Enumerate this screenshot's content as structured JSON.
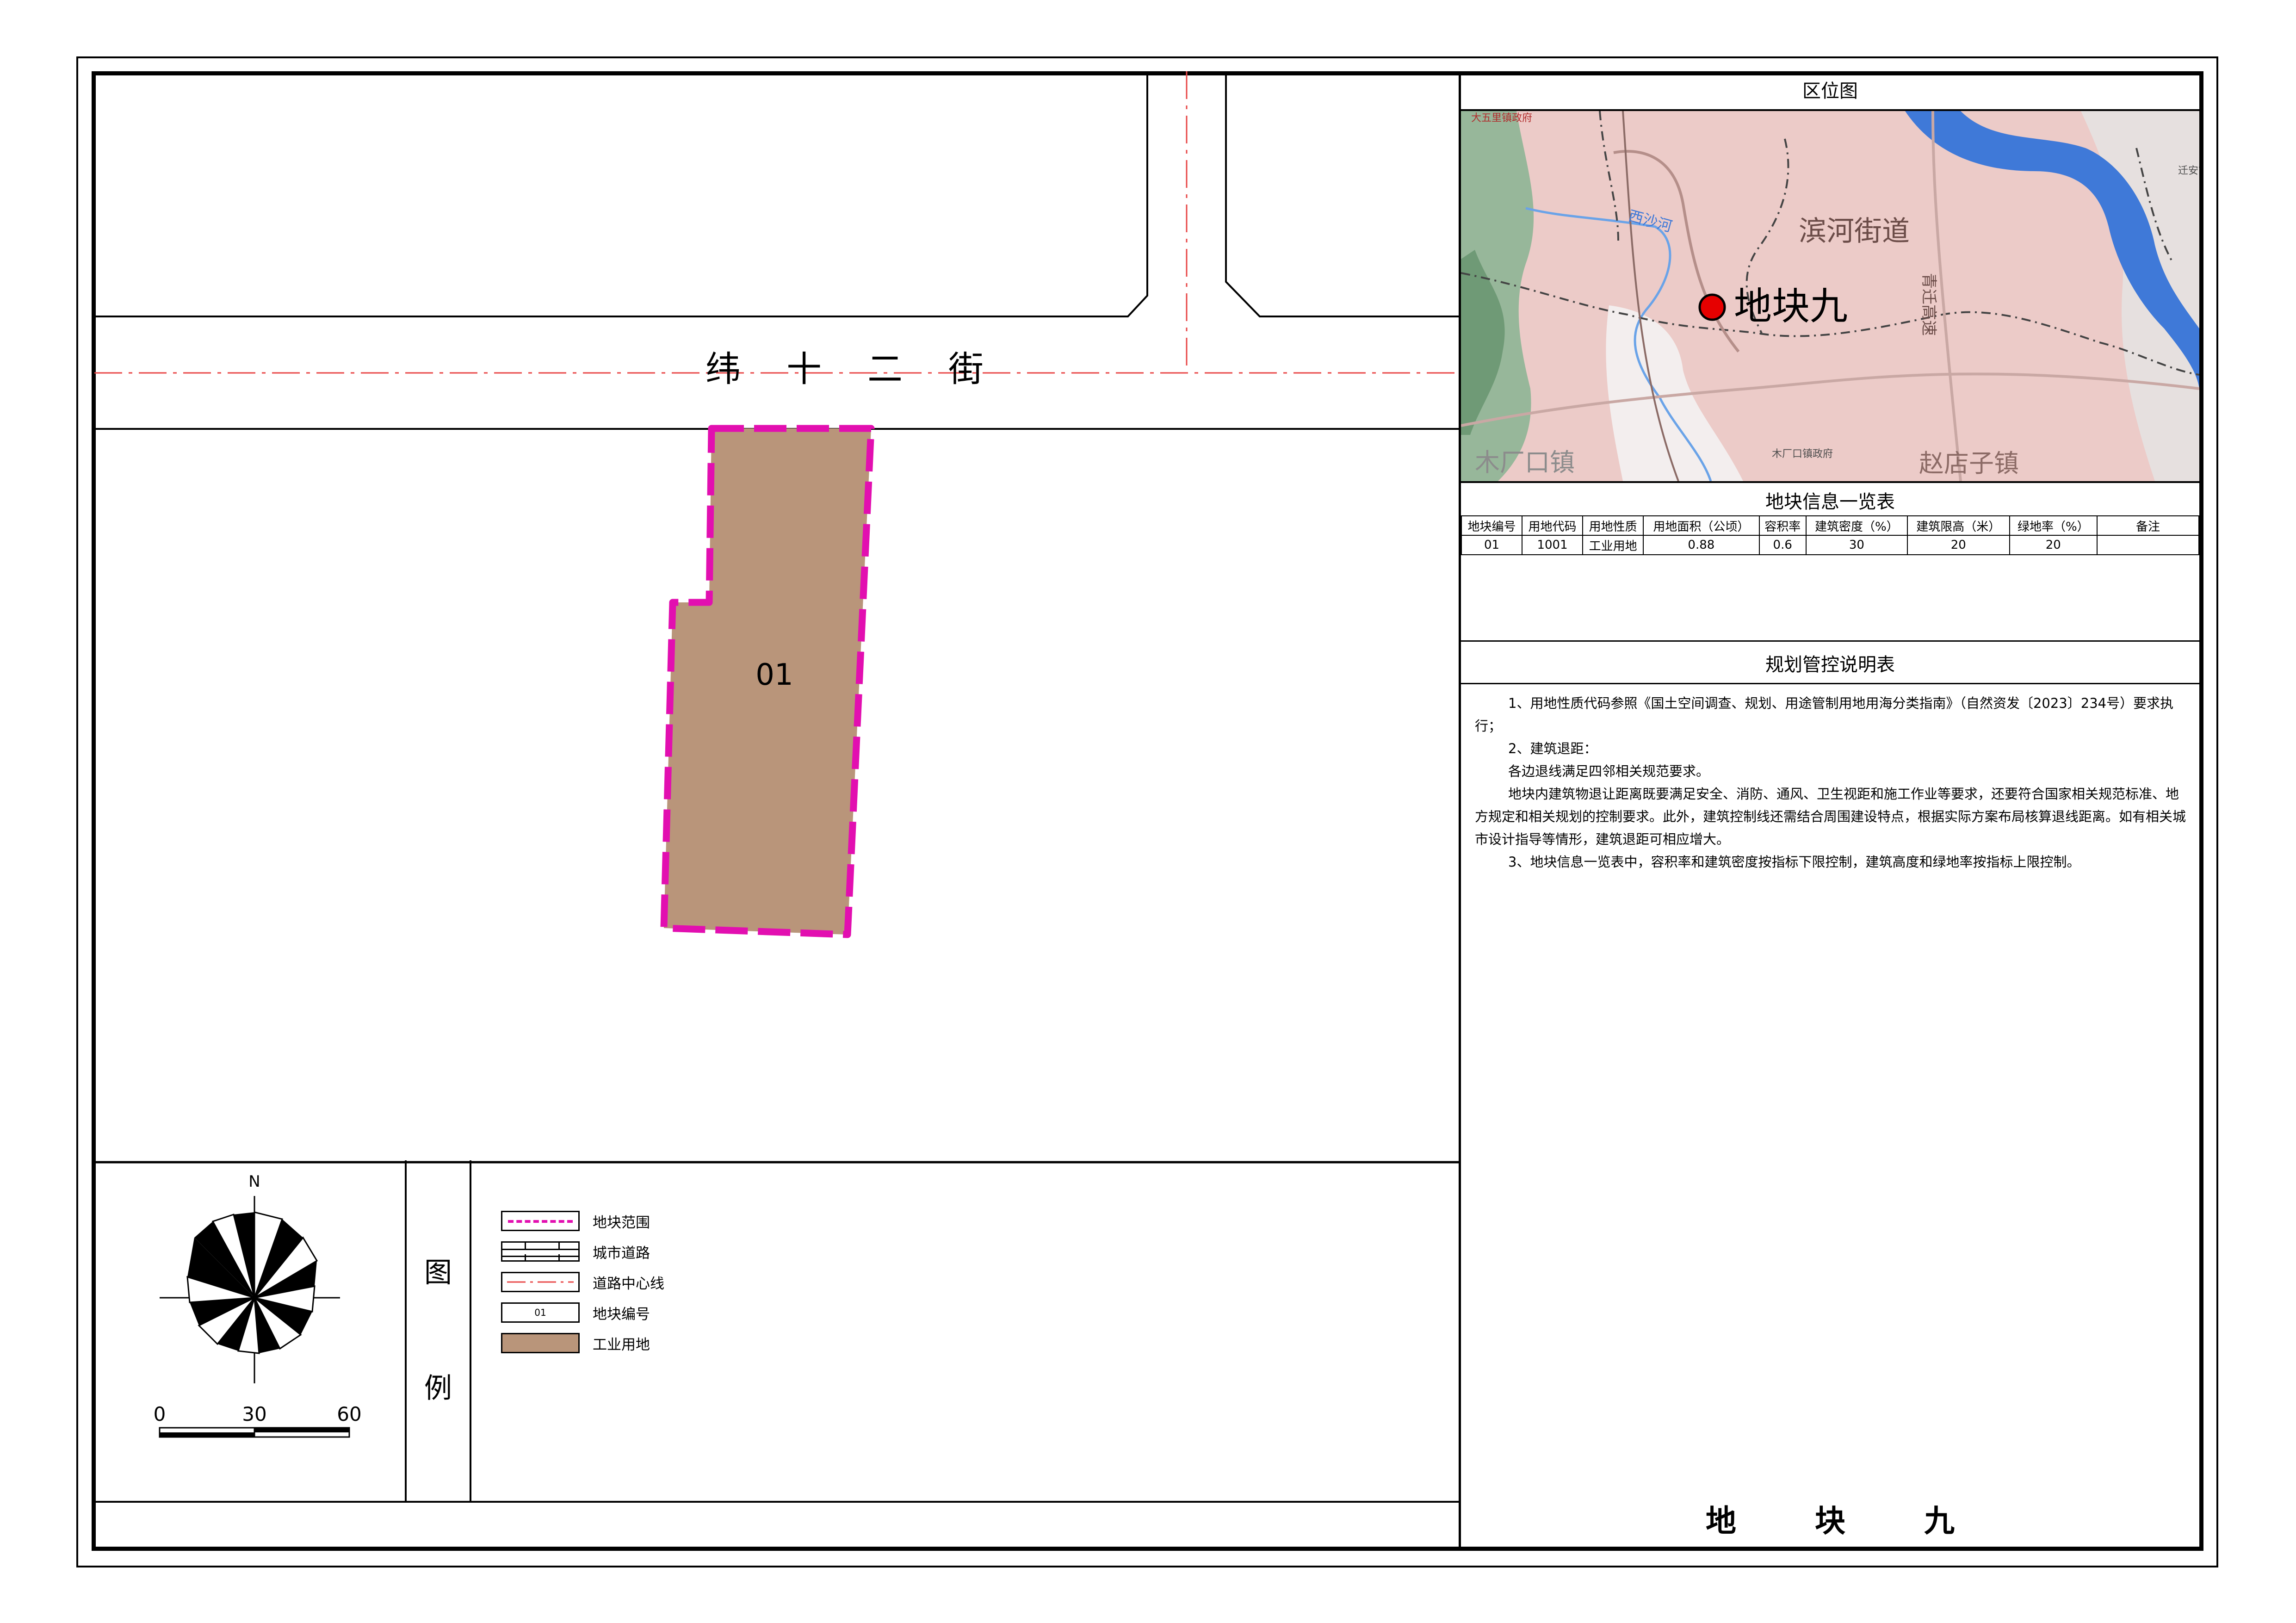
{
  "map": {
    "road_name_chars": [
      "纬",
      "十",
      "二",
      "街"
    ],
    "parcel_label": "01",
    "parcel_fill": "#b9957a",
    "boundary_color": "#e20fb0",
    "centerline_color": "#e84848"
  },
  "legend": {
    "title_chars": [
      "图",
      "例"
    ],
    "items": [
      {
        "icon": "dashed-magenta-line",
        "label": "地块范围"
      },
      {
        "icon": "city-road",
        "label": "城市道路"
      },
      {
        "icon": "red-dash-dot-line",
        "label": "道路中心线"
      },
      {
        "icon": "parcel-number-box",
        "label": "地块编号",
        "sample": "01"
      },
      {
        "icon": "industrial-fill",
        "label": "工业用地"
      }
    ],
    "north_label": "N",
    "scale": [
      "0",
      "30",
      "60"
    ]
  },
  "location_map": {
    "title": "区位图",
    "marker_label": "地块九",
    "places": [
      "滨河街道",
      "木厂口镇",
      "赵店子镇",
      "西沙河",
      "青迁高速",
      "大五里镇政府",
      "木厂口镇政府",
      "迁安市"
    ]
  },
  "info_table": {
    "title": "地块信息一览表",
    "headers": [
      "地块编号",
      "用地代码",
      "用地性质",
      "用地面积（公顷）",
      "容积率",
      "建筑密度（%）",
      "建筑限高（米）",
      "绿地率（%）",
      "备注"
    ],
    "rows": [
      [
        "01",
        "1001",
        "工业用地",
        "0.88",
        "0.6",
        "30",
        "20",
        "20",
        ""
      ]
    ]
  },
  "notes": {
    "title": "规划管控说明表",
    "paragraphs": [
      "1、用地性质代码参照《国土空间调查、规划、用途管制用地用海分类指南》（自然资发〔2023〕234号）要求执行；",
      "2、建筑退距：",
      "各边退线满足四邻相关规范要求。",
      "地块内建筑物退让距离既要满足安全、消防、通风、卫生视距和施工作业等要求，还要符合国家相关规范标准、地方规定和相关规划的控制要求。此外，建筑控制线还需结合周围建设特点，根据实际方案布局核算退线距离。如有相关城市设计指导等情形，建筑退距可相应增大。",
      "3、地块信息一览表中，容积率和建筑密度按指标下限控制，建筑高度和绿地率按指标上限控制。"
    ]
  },
  "footer_title_chars": [
    "地",
    "块",
    "九"
  ]
}
